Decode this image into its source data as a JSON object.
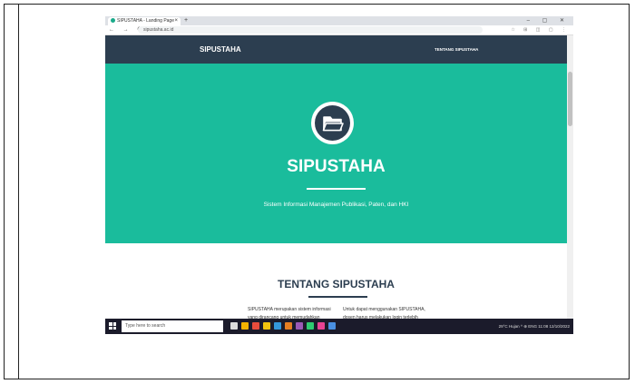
{
  "browser": {
    "tab_title": "SIPUSTAHA - Landing Page",
    "tab_close": "×",
    "new_tab": "+",
    "window_controls": "– ▢ ✕",
    "nav_controls": "← → C",
    "url": "sipustaha.ac.id",
    "extension_icons": "☆ ⊞ ◫ ▢ ⋮"
  },
  "site": {
    "brand": "SIPUSTAHA",
    "nav_link": "TENTANG SIPUSTAHA"
  },
  "hero": {
    "title": "SIPUSTAHA",
    "subtitle": "Sistem Informasi Manajemen Publikasi, Paten, dan HKI",
    "logo_icon": "folder-icon"
  },
  "about": {
    "title": "TENTANG SIPUSTAHA",
    "col1": "SIPUSTAHA merupakan sistem informasi yang dirancang untuk memudahkan dosen dalam menyimpan data-data publikasi, paten, dan HKI",
    "col2": "Untuk dapat menggunakan SIPUSTAHA, dosen harus melakukan login terlebih dahulu. Silahkan klik tombol login di bawah untuk melakukan login."
  },
  "taskbar": {
    "search_placeholder": "Type here to search",
    "tray_text": "29°C Hujan  ^  ⊕ ENG  11:08  12/10/2022"
  },
  "colors": {
    "navbar": "#2c3e50",
    "hero": "#1abc9c",
    "taskbar": "#1b1b2b"
  }
}
